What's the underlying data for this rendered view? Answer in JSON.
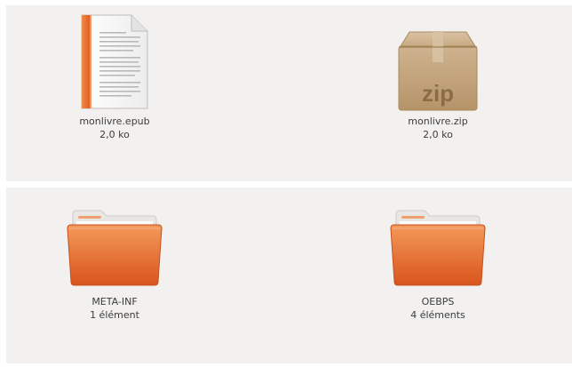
{
  "files": [
    {
      "name": "monlivre.epub",
      "meta": "2,0 ko",
      "icon": "epub-document-icon"
    },
    {
      "name": "monlivre.zip",
      "meta": "2,0 ko",
      "icon": "zip-archive-icon",
      "icon_text": "zip"
    }
  ],
  "folders": [
    {
      "name": "META-INF",
      "meta": "1 élément",
      "icon": "folder-icon"
    },
    {
      "name": "OEBPS",
      "meta": "4 éléments",
      "icon": "folder-icon"
    }
  ],
  "colors": {
    "panel_bg": "#f2f1f0",
    "folder_orange": "#e8692a",
    "epub_spine": "#e8692a",
    "zip_box": "#c4a57f"
  }
}
